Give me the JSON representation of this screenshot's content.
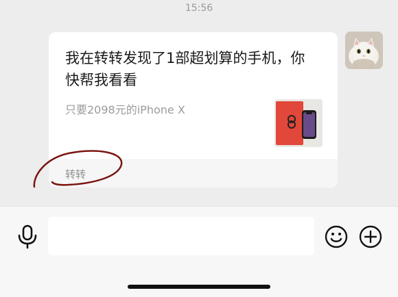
{
  "status": {
    "time": "15:56"
  },
  "message": {
    "title": "我在转转发现了1部超划算的手机，你快帮我看看",
    "subtitle": "只要2098元的iPhone X",
    "source": "转转",
    "thumbnail_icon": "phone-product-image"
  },
  "sender": {
    "avatar_icon": "cat-avatar"
  },
  "input_bar": {
    "voice_icon": "microphone-icon",
    "placeholder": "",
    "emoji_icon": "smiley-icon",
    "more_icon": "plus-circle-icon"
  },
  "colors": {
    "background": "#ededed",
    "card": "#ffffff",
    "annotation": "#7a1410",
    "thumb_box": "#e0483a"
  }
}
